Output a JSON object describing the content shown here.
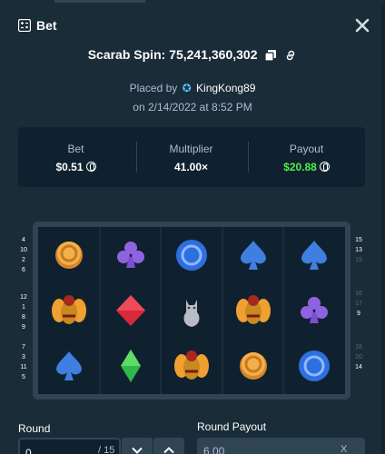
{
  "header": {
    "title": "Bet",
    "close_icon": "close-icon"
  },
  "game": {
    "name": "Scarab Spin",
    "bet_id": "75,241,360,302",
    "display": "Scarab Spin: 75,241,360,302"
  },
  "placed": {
    "prefix": "Placed by",
    "user": "KingKong89",
    "date": "on 2/14/2022 at 8:52 PM"
  },
  "stats": {
    "bet_label": "Bet",
    "bet_value": "$0.51",
    "multiplier_label": "Multiplier",
    "multiplier_value": "41.00×",
    "payout_label": "Payout",
    "payout_value": "$20.88"
  },
  "colors": {
    "payout_green": "#4ff04a",
    "background": "#1a2c38",
    "panel": "#0f212e"
  },
  "lines_left": [
    [
      "4",
      "10",
      "2",
      "6"
    ],
    [
      "12",
      "1",
      "8",
      "9"
    ],
    [
      "7",
      "3",
      "11",
      "5"
    ]
  ],
  "lines_right": [
    [
      "15",
      "13",
      "19"
    ],
    [
      "16",
      "17",
      "9"
    ],
    [
      "18",
      "20",
      "14"
    ]
  ],
  "lines_right_highlight": [
    "15",
    "13",
    "9",
    "14"
  ],
  "reels": [
    [
      "coin",
      "club",
      "ring",
      "spade",
      "spade"
    ],
    [
      "scarab",
      "diamond",
      "cat",
      "scarab",
      "club"
    ],
    [
      "spade",
      "emerald",
      "scarab",
      "coin",
      "ring"
    ]
  ],
  "round": {
    "label": "Round",
    "value": "0",
    "total": "/ 15"
  },
  "round_payout": {
    "label": "Round Payout",
    "value": "6.00",
    "suffix": "X"
  }
}
